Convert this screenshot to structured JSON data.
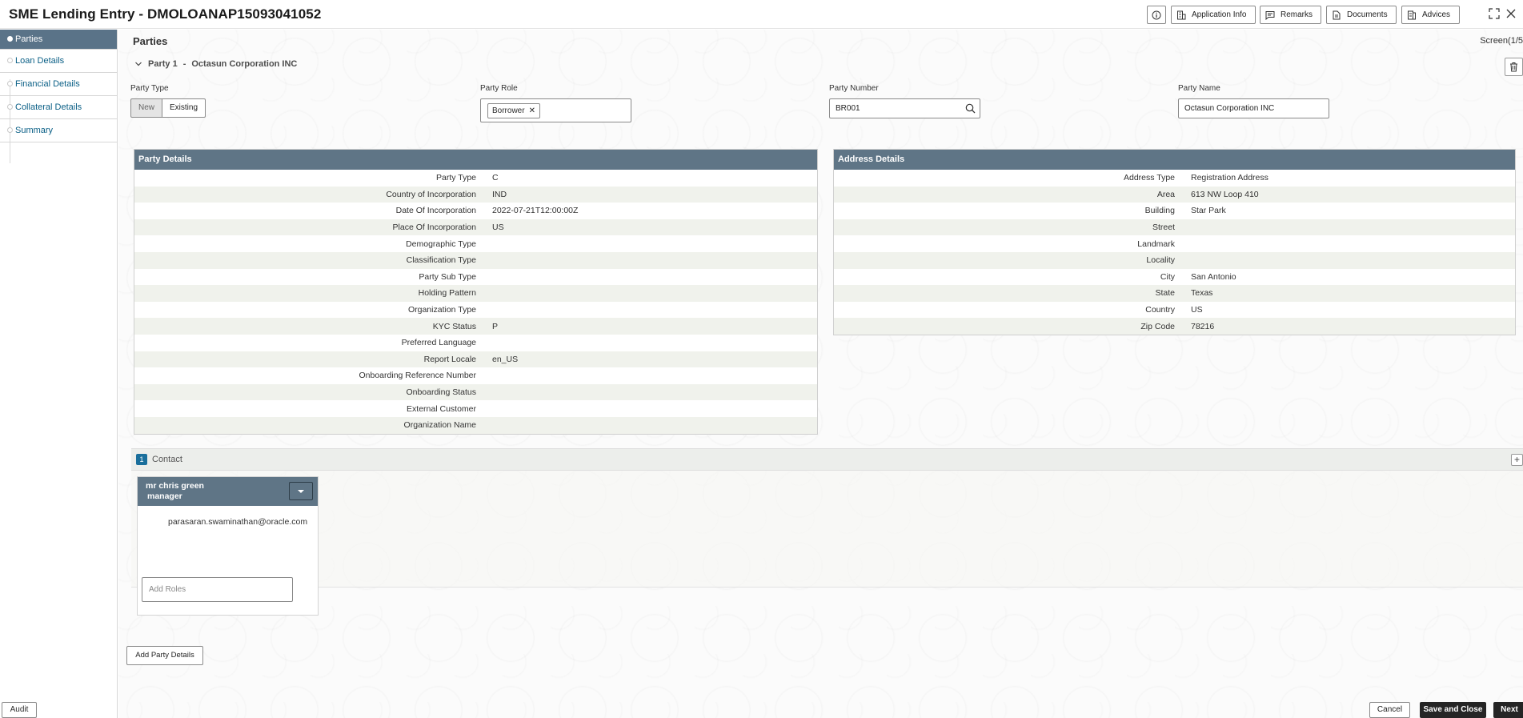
{
  "header": {
    "title": "SME Lending Entry - DMOLOANAP15093041052",
    "buttons": {
      "application_info": "Application Info",
      "remarks": "Remarks",
      "documents": "Documents",
      "advices": "Advices"
    }
  },
  "sidebar": {
    "items": [
      {
        "label": "Parties"
      },
      {
        "label": "Loan Details"
      },
      {
        "label": "Financial Details"
      },
      {
        "label": "Collateral Details"
      },
      {
        "label": "Summary"
      }
    ],
    "audit_label": "Audit"
  },
  "main": {
    "page_title": "Parties",
    "screen_label": "Screen(1/5",
    "party_header": {
      "number": "Party 1",
      "separator": "-",
      "name": "Octasun Corporation INC"
    },
    "fields": {
      "party_type": {
        "label": "Party Type",
        "options": [
          "New",
          "Existing"
        ],
        "selected": "New"
      },
      "party_role": {
        "label": "Party Role",
        "chip": "Borrower"
      },
      "party_number": {
        "label": "Party Number",
        "value": "BR001"
      },
      "party_name": {
        "label": "Party Name",
        "value": "Octasun Corporation INC"
      }
    },
    "party_details": {
      "title": "Party Details",
      "rows": [
        {
          "label": "Party Type",
          "value": "C"
        },
        {
          "label": "Country of Incorporation",
          "value": "IND"
        },
        {
          "label": "Date Of Incorporation",
          "value": "2022-07-21T12:00:00Z"
        },
        {
          "label": "Place Of Incorporation",
          "value": "US"
        },
        {
          "label": "Demographic Type",
          "value": ""
        },
        {
          "label": "Classification Type",
          "value": ""
        },
        {
          "label": "Party Sub Type",
          "value": ""
        },
        {
          "label": "Holding Pattern",
          "value": ""
        },
        {
          "label": "Organization Type",
          "value": ""
        },
        {
          "label": "KYC Status",
          "value": "P"
        },
        {
          "label": "Preferred Language",
          "value": ""
        },
        {
          "label": "Report Locale",
          "value": "en_US"
        },
        {
          "label": "Onboarding Reference Number",
          "value": ""
        },
        {
          "label": "Onboarding Status",
          "value": ""
        },
        {
          "label": "External Customer",
          "value": ""
        },
        {
          "label": "Organization Name",
          "value": ""
        }
      ]
    },
    "address_details": {
      "title": "Address Details",
      "rows": [
        {
          "label": "Address Type",
          "value": "Registration Address"
        },
        {
          "label": "Area",
          "value": "613 NW Loop 410"
        },
        {
          "label": "Building",
          "value": "Star Park"
        },
        {
          "label": "Street",
          "value": ""
        },
        {
          "label": "Landmark",
          "value": ""
        },
        {
          "label": "Locality",
          "value": ""
        },
        {
          "label": "City",
          "value": "San Antonio"
        },
        {
          "label": "State",
          "value": "Texas"
        },
        {
          "label": "Country",
          "value": "US"
        },
        {
          "label": "Zip Code",
          "value": "78216"
        }
      ]
    },
    "contact": {
      "count": "1",
      "label": "Contact",
      "card": {
        "name": "mr  chris  green",
        "designation": "manager",
        "email": "parasaran.swaminathan@oracle.com",
        "roles_placeholder": "Add Roles"
      }
    },
    "add_party_label": "Add Party Details"
  },
  "footer": {
    "cancel": "Cancel",
    "save_close": "Save and Close",
    "next": "Next"
  },
  "colors": {
    "panel_header": "#5f7586",
    "sidebar_active": "#5a7388",
    "link": "#0a5f86",
    "primary_button": "#252525"
  }
}
